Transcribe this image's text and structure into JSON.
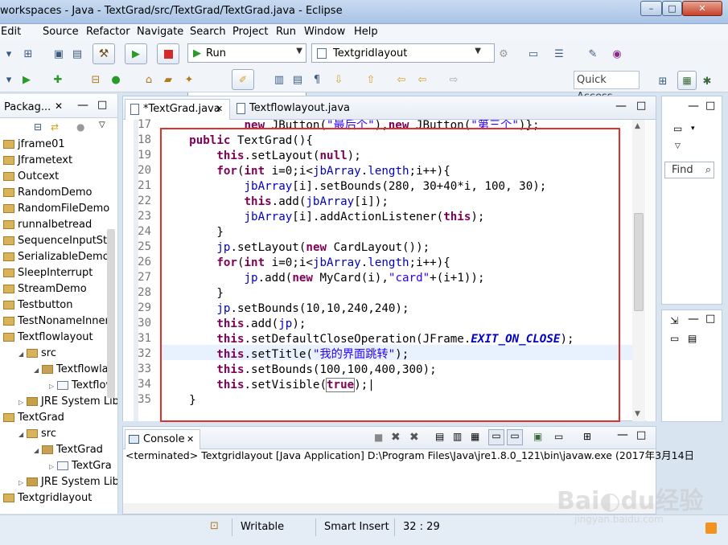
{
  "window": {
    "title": "workspaces - Java - TextGrad/src/TextGrad/TextGrad.java - Eclipse",
    "min_glyph": "–",
    "max_glyph": "□",
    "close_glyph": "✕"
  },
  "menu": [
    "Edit",
    "Source",
    "Refactor",
    "Navigate",
    "Search",
    "Project",
    "Run",
    "Window",
    "Help"
  ],
  "toolbar": {
    "run_label": "Run",
    "launch_config": "Textgridlayout",
    "quick_access": "Quick Access"
  },
  "package_explorer": {
    "tab_label": "Packag...",
    "items": [
      {
        "label": "jframe01",
        "indent": 0,
        "type": "project"
      },
      {
        "label": "Jframetext",
        "indent": 0,
        "type": "project"
      },
      {
        "label": "Outcext",
        "indent": 0,
        "type": "project"
      },
      {
        "label": "RandomDemo",
        "indent": 0,
        "type": "project"
      },
      {
        "label": "RandomFileDemo",
        "indent": 0,
        "type": "project"
      },
      {
        "label": "runnalbetread",
        "indent": 0,
        "type": "project"
      },
      {
        "label": "SequenceInputStr",
        "indent": 0,
        "type": "project"
      },
      {
        "label": "SerializableDemo",
        "indent": 0,
        "type": "project"
      },
      {
        "label": "SleepInterrupt",
        "indent": 0,
        "type": "project"
      },
      {
        "label": "StreamDemo",
        "indent": 0,
        "type": "project"
      },
      {
        "label": "Testbutton",
        "indent": 0,
        "type": "project"
      },
      {
        "label": "TestNonameInner",
        "indent": 0,
        "type": "project"
      },
      {
        "label": "Textflowlayout",
        "indent": 0,
        "type": "project"
      },
      {
        "label": "src",
        "indent": 1,
        "type": "src"
      },
      {
        "label": "Textflowlay",
        "indent": 2,
        "type": "pkg"
      },
      {
        "label": "Textflov",
        "indent": 3,
        "type": "java"
      },
      {
        "label": "JRE System Lib",
        "indent": 1,
        "type": "lib"
      },
      {
        "label": "TextGrad",
        "indent": 0,
        "type": "project"
      },
      {
        "label": "src",
        "indent": 1,
        "type": "src"
      },
      {
        "label": "TextGrad",
        "indent": 2,
        "type": "pkg"
      },
      {
        "label": "TextGra",
        "indent": 3,
        "type": "java"
      },
      {
        "label": "JRE System Lib",
        "indent": 1,
        "type": "lib"
      },
      {
        "label": "Textgridlayout",
        "indent": 0,
        "type": "project"
      }
    ]
  },
  "editor": {
    "tabs": [
      "*TextGrad.java",
      "Textflowlayout.java"
    ],
    "lines": [
      {
        "n": "17",
        "html": "            <span class=\"kw\">new</span> JButton(<span class=\"str\">\"最后个\"</span>),<span class=\"kw\">new</span> JButton(<span class=\"str\">\"第三个\"</span>)};"
      },
      {
        "n": "18",
        "html": "    <span class=\"kw\">public</span> TextGrad(){"
      },
      {
        "n": "19",
        "html": "        <span class=\"kw\">this</span>.setLayout(<span class=\"kw\">null</span>);"
      },
      {
        "n": "20",
        "html": "        <span class=\"kw\">for</span>(<span class=\"kw\">int</span> i=0;i&lt;<span class=\"fld\">jbArray</span>.<span class=\"fld\">length</span>;i++){"
      },
      {
        "n": "21",
        "html": "            <span class=\"fld\">jbArray</span>[i].setBounds(280, 30+40*i, 100, 30);"
      },
      {
        "n": "22",
        "html": "            <span class=\"kw\">this</span>.add(<span class=\"fld\">jbArray</span>[i]);"
      },
      {
        "n": "23",
        "html": "            <span class=\"fld\">jbArray</span>[i].addActionListener(<span class=\"kw\">this</span>);"
      },
      {
        "n": "24",
        "html": "        }"
      },
      {
        "n": "25",
        "html": "        <span class=\"fld\">jp</span>.setLayout(<span class=\"kw\">new</span> CardLayout());"
      },
      {
        "n": "26",
        "html": "        <span class=\"kw\">for</span>(<span class=\"kw\">int</span> i=0;i&lt;<span class=\"fld\">jbArray</span>.<span class=\"fld\">length</span>;i++){"
      },
      {
        "n": "27",
        "html": "            <span class=\"fld\">jp</span>.add(<span class=\"kw\">new</span> MyCard(i),<span class=\"str\">\"card\"</span>+(i+1));"
      },
      {
        "n": "28",
        "html": "        }"
      },
      {
        "n": "29",
        "html": "        <span class=\"fld\">jp</span>.setBounds(10,10,240,240);"
      },
      {
        "n": "30",
        "html": "        <span class=\"kw\">this</span>.add(<span class=\"fld\">jp</span>);"
      },
      {
        "n": "31",
        "html": "        <span class=\"kw\">this</span>.setDefaultCloseOperation(JFrame.<span class=\"cst\">EXIT_ON_CLOSE</span>);"
      },
      {
        "n": "32",
        "html": "        <span class=\"kw\">this</span>.setTitle(<span class=\"str\">\"我的界面跳转\"</span>);"
      },
      {
        "n": "33",
        "html": "        <span class=\"kw\">this</span>.setBounds(100,100,400,300);"
      },
      {
        "n": "34",
        "html": "        <span class=\"kw\">this</span>.setVisible(<span class=\"kw\" style=\"outline:1px solid #777\">true</span>);|"
      },
      {
        "n": "35",
        "html": "    }"
      }
    ]
  },
  "outline": {
    "find_label": "Find"
  },
  "console": {
    "tab_label": "Console",
    "text": "<terminated> Textgridlayout [Java Application] D:\\Program Files\\Java\\jre1.8.0_121\\bin\\javaw.exe (2017年3月14日"
  },
  "status": {
    "writable": "Writable",
    "insert_mode": "Smart Insert",
    "position": "32 : 29"
  },
  "watermark": {
    "logo": "Bai◐du经验",
    "url": "jingyan.baidu.com"
  },
  "colors": {
    "highlight_box": "#e0302a",
    "keyword": "#7f0055",
    "field": "#0000c0",
    "string": "#2a00ff"
  }
}
